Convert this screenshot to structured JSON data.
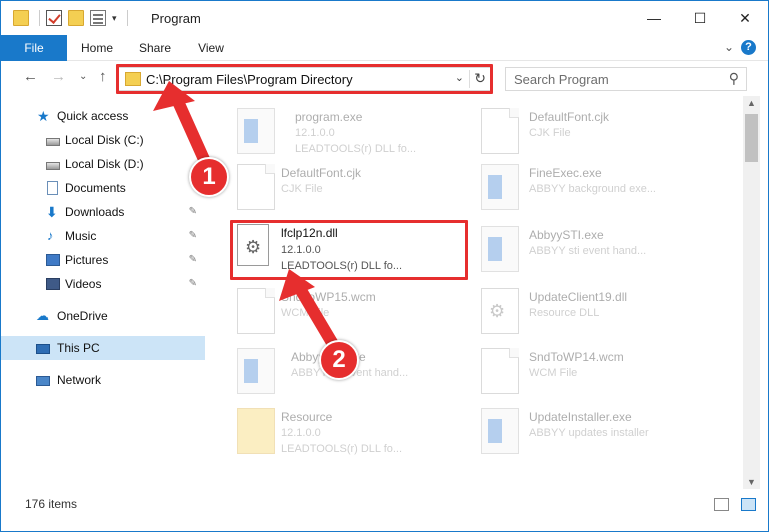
{
  "window": {
    "title": "Program",
    "minimize": "—",
    "maximize": "☐",
    "close": "✕"
  },
  "ribbon": {
    "tabs": [
      "File",
      "Home",
      "Share",
      "View"
    ],
    "expand": "⌄",
    "help": "?"
  },
  "navbar": {
    "back": "←",
    "forward": "→",
    "recent": "⌄",
    "up": "↑",
    "address": "C:\\Program Files\\Program Directory",
    "address_dropdown": "⌄",
    "refresh": "↻",
    "search_placeholder": "Search Program",
    "search_icon": "⚲"
  },
  "nav_pane": {
    "items": [
      {
        "label": "Quick access",
        "icon": "star-icon"
      },
      {
        "label": "Local Disk (C:)",
        "icon": "disk-icon"
      },
      {
        "label": "Local Disk (D:)",
        "icon": "disk-icon"
      },
      {
        "label": "Documents",
        "icon": "documents-icon"
      },
      {
        "label": "Downloads",
        "icon": "downloads-icon"
      },
      {
        "label": "Music",
        "icon": "music-icon"
      },
      {
        "label": "Pictures",
        "icon": "pictures-icon"
      },
      {
        "label": "Videos",
        "icon": "videos-icon"
      },
      {
        "label": "OneDrive",
        "icon": "onedrive-icon"
      },
      {
        "label": "This PC",
        "icon": "this-pc-icon"
      },
      {
        "label": "Network",
        "icon": "network-icon"
      }
    ],
    "pin_glyph": "📌"
  },
  "files": [
    {
      "name": "program.exe",
      "line2": "12.1.0.0",
      "line3": "LEADTOOLS(r) DLL fo...",
      "icon": "application-icon"
    },
    {
      "name": "DefaultFont.cjk",
      "line2": "CJK File",
      "line3": "",
      "icon": "file-icon"
    },
    {
      "name": "DefaultFont.cjk",
      "line2": "CJK File",
      "line3": "",
      "icon": "file-icon"
    },
    {
      "name": "FineExec.exe",
      "line2": "ABBYY background exe...",
      "line3": "",
      "icon": "application-icon"
    },
    {
      "name": "lfclp12n.dll",
      "line2": "12.1.0.0",
      "line3": "LEADTOOLS(r) DLL fo...",
      "icon": "dll-gear-icon"
    },
    {
      "name": "AbbyySTI.exe",
      "line2": "ABBYY sti event hand...",
      "line3": "",
      "icon": "application-icon"
    },
    {
      "name": "SndToWP15.wcm",
      "line2": "WCM File",
      "line3": "",
      "icon": "file-icon"
    },
    {
      "name": "UpdateClient19.dll",
      "line2": "Resource DLL",
      "line3": "",
      "icon": "dll-gear-icon"
    },
    {
      "name": "AbbyySTI.exe",
      "line2": "ABBYY sti event hand...",
      "line3": "",
      "icon": "application-icon"
    },
    {
      "name": "SndToWP14.wcm",
      "line2": "WCM File",
      "line3": "",
      "icon": "file-icon"
    },
    {
      "name": "Resource",
      "line2": "12.1.0.0",
      "line3": "LEADTOOLS(r) DLL fo...",
      "icon": "folder-icon"
    },
    {
      "name": "UpdateInstaller.exe",
      "line2": "ABBYY updates installer",
      "line3": "",
      "icon": "application-icon"
    }
  ],
  "status": {
    "item_count": "176 items"
  },
  "annotations": {
    "badge1": "1",
    "badge2": "2",
    "color": "#e62e2e"
  },
  "colors": {
    "accent": "#1979ca",
    "selected": "#cce4f7"
  }
}
